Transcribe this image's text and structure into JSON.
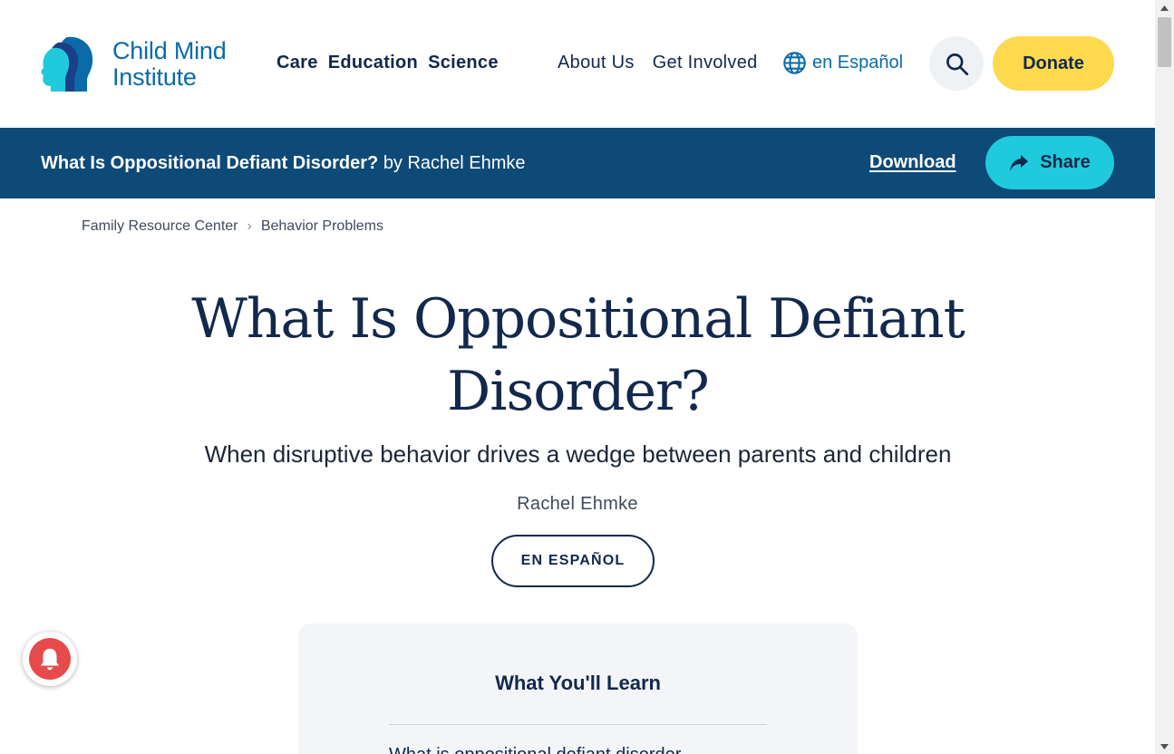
{
  "header": {
    "logo_line1": "Child Mind",
    "logo_line2": "Institute",
    "nav_primary": [
      "Care",
      "Education",
      "Science"
    ],
    "nav_secondary": [
      "About Us",
      "Get Involved"
    ],
    "language_link": "en Español",
    "donate_label": "Donate"
  },
  "article_bar": {
    "title": "What Is Oppositional Defiant Disorder?",
    "byline": "by Rachel Ehmke",
    "download_label": "Download",
    "share_label": "Share"
  },
  "breadcrumb": [
    "Family Resource Center",
    "Behavior Problems"
  ],
  "article": {
    "title_line1": "What Is Oppositional Defiant",
    "title_line2": "Disorder?",
    "subtitle": "When disruptive behavior drives a wedge between parents and children",
    "author": "Rachel Ehmke",
    "espanol_button": "EN ESPAÑOL"
  },
  "learn_box": {
    "heading": "What You'll Learn",
    "first_item": "What is oppositional defiant disorder"
  },
  "colors": {
    "brand_navy": "#12284c",
    "brand_blue": "#0a6ba8",
    "bar_blue": "#0e4a77",
    "donate_yellow": "#fdd94d",
    "share_cyan": "#1ecadb",
    "bell_red": "#e54b4b"
  },
  "icons": {
    "logo": "child-mind-heads-logo",
    "language": "globe-icon",
    "search": "search-icon",
    "share": "share-arrow-icon",
    "breadcrumb_separator": "chevron-right-icon",
    "notification": "bell-icon"
  }
}
